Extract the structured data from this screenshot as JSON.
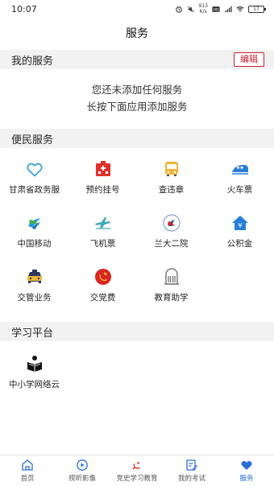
{
  "status_bar": {
    "time": "10:07",
    "network_speed": "913",
    "network_unit": "K/s",
    "battery": "17"
  },
  "header": {
    "title": "服务"
  },
  "my_services": {
    "title": "我的服务",
    "edit_label": "编辑",
    "empty_line1": "您还未添加任何服务",
    "empty_line2": "长按下面应用添加服务"
  },
  "public_services": {
    "title": "便民服务",
    "items": [
      {
        "label": "甘肃省政务服",
        "icon": "heart-outline-icon"
      },
      {
        "label": "预约挂号",
        "icon": "hospital-icon"
      },
      {
        "label": "查违章",
        "icon": "bus-icon"
      },
      {
        "label": "火车票",
        "icon": "train-icon"
      },
      {
        "label": "中国移动",
        "icon": "china-mobile-icon"
      },
      {
        "label": "飞机票",
        "icon": "airplane-icon"
      },
      {
        "label": "兰大二院",
        "icon": "hospital-logo-icon"
      },
      {
        "label": "公积金",
        "icon": "house-fund-icon"
      },
      {
        "label": "交管业务",
        "icon": "taxi-icon"
      },
      {
        "label": "交党费",
        "icon": "party-emblem-icon"
      },
      {
        "label": "教育助学",
        "icon": "school-building-icon"
      }
    ]
  },
  "study_platform": {
    "title": "学习平台",
    "items": [
      {
        "label": "中小学网络云",
        "icon": "reading-person-icon"
      }
    ]
  },
  "tabs": [
    {
      "label": "首页",
      "icon": "home-icon",
      "active": false
    },
    {
      "label": "视听影像",
      "icon": "play-circle-icon",
      "active": false
    },
    {
      "label": "党史学习教育",
      "icon": "party-emblem-icon",
      "active": false
    },
    {
      "label": "我的考试",
      "icon": "exam-edit-icon",
      "active": false
    },
    {
      "label": "服务",
      "icon": "heart-icon",
      "active": true
    }
  ],
  "colors": {
    "accent": "#2a6fd6",
    "party_red": "#d8261f",
    "edit_red": "#c8202b",
    "section_bg": "#f2f2f2"
  }
}
